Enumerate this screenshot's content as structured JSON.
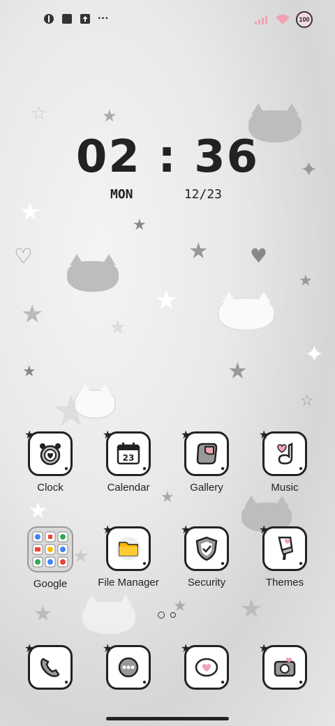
{
  "status_bar": {
    "left_icons": [
      "app-badge-icon",
      "square-notification-icon",
      "upload-notification-icon",
      "more-dots-icon"
    ],
    "more_glyph": "···",
    "battery_level": "100"
  },
  "lock_clock": {
    "time": "02 : 36",
    "day": "MON",
    "date": "12/23"
  },
  "home": {
    "row1": [
      {
        "label": "Clock",
        "icon": "alarm-clock-icon"
      },
      {
        "label": "Calendar",
        "icon": "calendar-icon",
        "glyph_text": "23"
      },
      {
        "label": "Gallery",
        "icon": "gallery-icon"
      },
      {
        "label": "Music",
        "icon": "music-icon"
      }
    ],
    "row2": [
      {
        "label": "Google",
        "icon": "google-folder-icon"
      },
      {
        "label": "File Manager",
        "icon": "folder-icon"
      },
      {
        "label": "Security",
        "icon": "shield-icon"
      },
      {
        "label": "Themes",
        "icon": "brush-icon"
      }
    ],
    "page_indicator": {
      "current": 1,
      "total": 2
    },
    "dock": [
      {
        "icon": "phone-icon"
      },
      {
        "icon": "chat-bubble-icon"
      },
      {
        "icon": "message-heart-icon"
      },
      {
        "icon": "camera-icon"
      }
    ]
  },
  "colors": {
    "outline": "#222222",
    "accent_pink": "#f0a3b4",
    "folder_yellow": "#ffb300"
  }
}
